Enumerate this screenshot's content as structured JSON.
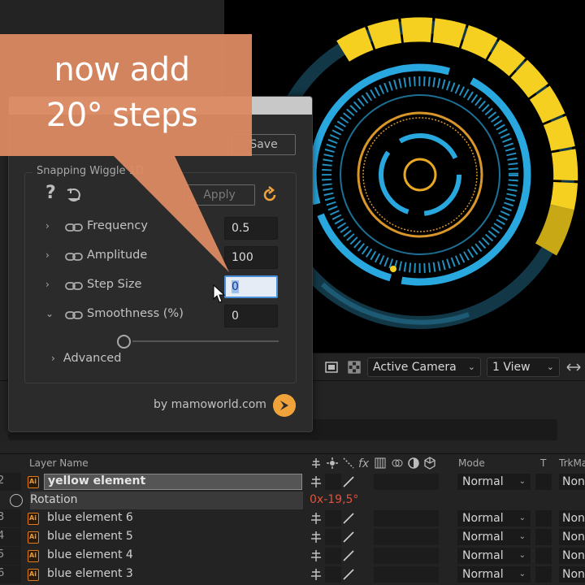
{
  "annotation": {
    "line1": "now add",
    "line2": "20° steps",
    "color": "#dc8a63"
  },
  "dialog": {
    "save_label": "Save",
    "group_title": "Snapping Wiggle 1D",
    "help_label": "?",
    "apply_label": "Apply",
    "params": [
      {
        "label": "Frequency",
        "value": "0.5",
        "twirl": "›"
      },
      {
        "label": "Amplitude",
        "value": "100",
        "twirl": "›"
      },
      {
        "label": "Step Size",
        "value": "0",
        "twirl": "›"
      },
      {
        "label": "Smoothness (%)",
        "value": "0",
        "twirl": "⌄"
      }
    ],
    "smoothness_slider": 0,
    "advanced_label": "Advanced",
    "credit": "by mamoworld.com"
  },
  "viewer_toolbar": {
    "camera": "Active Camera",
    "view": "1 View"
  },
  "timeline": {
    "headers": {
      "layer_name": "Layer Name",
      "mode": "Mode",
      "t": "T",
      "trkmat": "TrkMa",
      "fx": "fx"
    },
    "rows": [
      {
        "index": "2",
        "name": "yellow element",
        "mode": "Normal",
        "trk": "Non",
        "selected": true
      },
      {
        "index": "3",
        "name": "blue element 6",
        "mode": "Normal",
        "trk": "Non"
      },
      {
        "index": "4",
        "name": "blue element 5",
        "mode": "Normal",
        "trk": "Non"
      },
      {
        "index": "5",
        "name": "blue element 4",
        "mode": "Normal",
        "trk": "Non"
      },
      {
        "index": "6",
        "name": "blue element 3",
        "mode": "Normal",
        "trk": "Non"
      }
    ],
    "rotation": {
      "label": "Rotation",
      "value_revs": "0x",
      "value_deg": "-19,5°"
    }
  },
  "colors": {
    "accent_yellow": "#f5d020",
    "accent_blue": "#29a8e0",
    "focus_blue": "#4a90d9",
    "orange": "#e07a1a"
  }
}
